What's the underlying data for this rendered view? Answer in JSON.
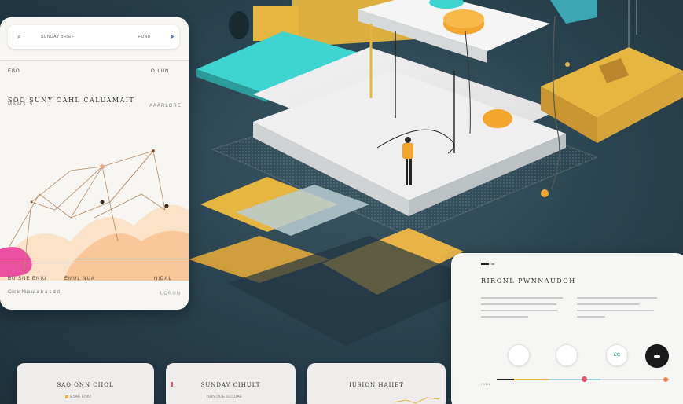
{
  "left_card": {
    "search_label": "SUNDAY BRIEF",
    "search_right": "FUND",
    "menu_left": "EBO",
    "menu_right": "O LUN",
    "title": "SOO SUNY OAHL CALUAMAIT",
    "meta_left": "MAALLIS",
    "meta_right": "AAARLORE",
    "footer_row_left": "BUISNE  ENIU",
    "footer_row_mid": "EMUL  NUA",
    "footer_row_right": "NIDAL",
    "footer_caption": "Cils is Nus ui a-b-a-c-d-d",
    "footer_tag": "LORUN"
  },
  "right_card": {
    "title": "RIRONL PWNNAUDOH",
    "circle_labels": [
      "",
      "",
      "CC",
      ""
    ],
    "slider_left": "ISDE"
  },
  "bottom_cards": [
    {
      "title": "SAO ONN CIIOL",
      "sub": "ESAE  ENIU"
    },
    {
      "title": "SUNDAY CIHULT",
      "sub": "NUN DUE SCCUAE"
    },
    {
      "title": "IUSION HAIIET",
      "sub": ""
    }
  ],
  "colors": {
    "accent_yellow": "#e5b640",
    "accent_teal": "#3ed4d0",
    "accent_orange": "#f3a72e",
    "background": "#243a47"
  }
}
